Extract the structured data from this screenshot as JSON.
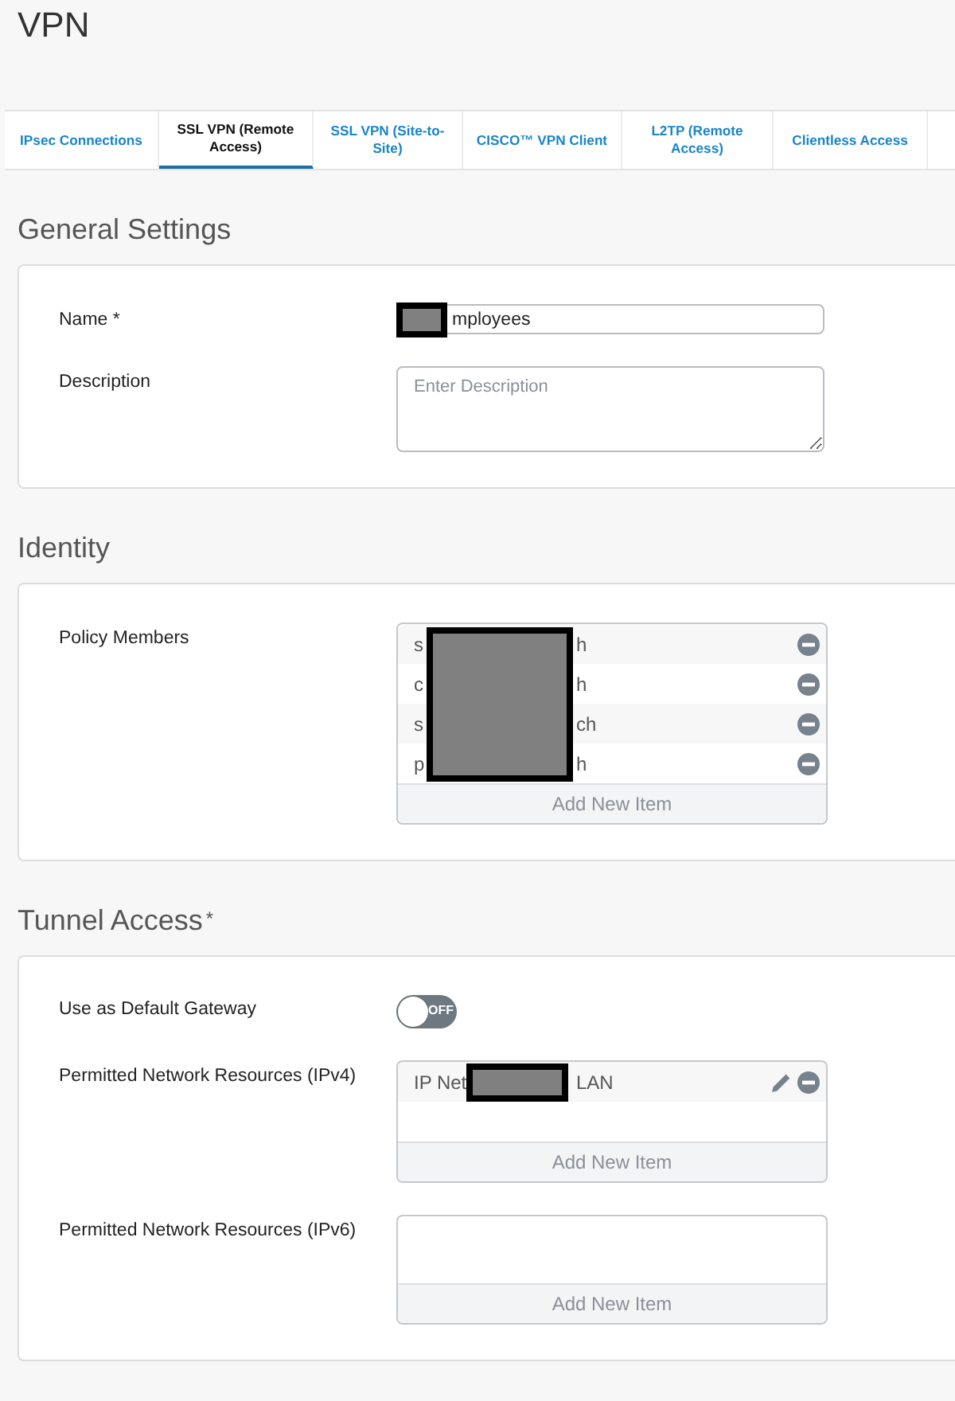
{
  "page_title": "VPN",
  "tabs": [
    {
      "label": "IPsec Connections",
      "selected": false
    },
    {
      "label": "SSL VPN (Remote Access)",
      "selected": true
    },
    {
      "label": "SSL VPN (Site-to-Site)",
      "selected": false
    },
    {
      "label": "CISCO™ VPN Client",
      "selected": false
    },
    {
      "label": "L2TP (Remote Access)",
      "selected": false
    },
    {
      "label": "Clientless Access",
      "selected": false
    }
  ],
  "sections": [
    {
      "title": "General Settings",
      "fields": [
        {
          "kind": "text",
          "label": "Name *",
          "value": "mployees",
          "redacted": true
        },
        {
          "kind": "textarea",
          "label": "Description",
          "placeholder": "Enter Description"
        }
      ]
    },
    {
      "title": "Identity",
      "fields": [
        {
          "kind": "list",
          "label": "Policy Members",
          "redacted": true,
          "add_label": "Add New Item",
          "items": [
            {
              "start": "s",
              "end": "h",
              "editable": false
            },
            {
              "start": "c",
              "end": "h",
              "editable": false
            },
            {
              "start": "s",
              "end": "ch",
              "editable": false
            },
            {
              "start": "p",
              "end": "h",
              "editable": false
            }
          ]
        }
      ]
    },
    {
      "title": "Tunnel Access",
      "required_mark": "*",
      "fields": [
        {
          "kind": "toggle",
          "label": "Use as Default Gateway",
          "on": false,
          "state_label": "OFF"
        },
        {
          "kind": "list",
          "label": "Permitted Network Resources (IPv4)",
          "redacted": true,
          "add_label": "Add New Item",
          "items": [
            {
              "start": "IP Net",
              "end": "LAN",
              "editable": true
            }
          ]
        },
        {
          "kind": "list",
          "label": "Permitted Network Resources (IPv6)",
          "add_label": "Add New Item"
        }
      ]
    }
  ]
}
